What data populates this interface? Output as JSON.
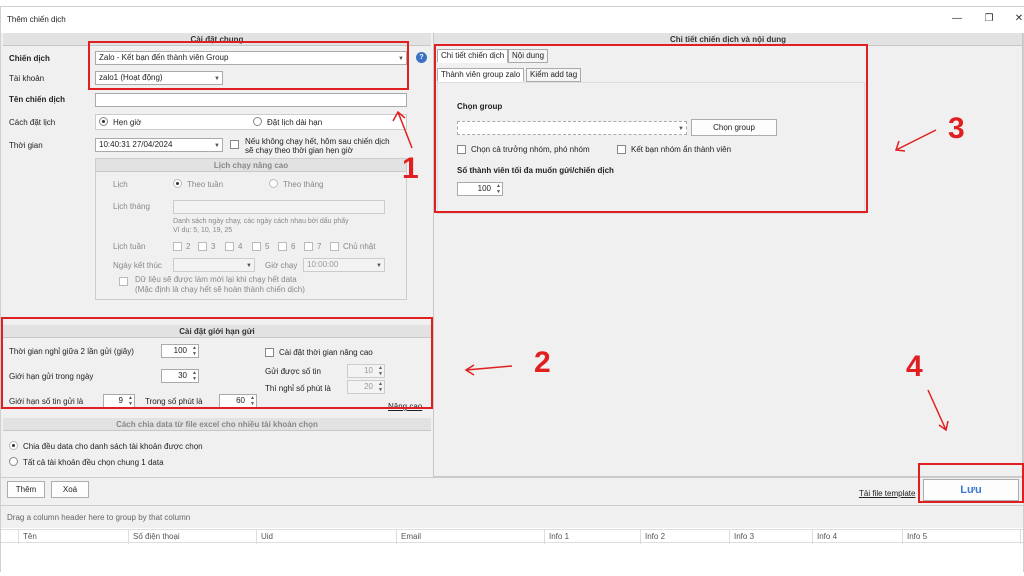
{
  "window": {
    "title": "Thêm chiến dịch",
    "minimize": "—",
    "restore": "❐",
    "close": "✕"
  },
  "general": {
    "header": "Cài đặt chung",
    "campaign_label": "Chiến dịch",
    "campaign_value": "Zalo - Kết bạn đến thành viên Group",
    "account_label": "Tài khoản",
    "account_value": "zalo1 (Hoạt động)",
    "name_label": "Tên chiến dịch",
    "name_value": "",
    "schedule_label": "Cách đặt lịch",
    "schedule_opt1": "Hẹn giờ",
    "schedule_opt2": "Đặt lịch dài hạn",
    "time_label": "Thời gian",
    "time_value": "10:40:31 27/04/2024",
    "rerun_note_1": "Nếu không chạy hết, hôm sau chiến dịch",
    "rerun_note_2": "sẽ chạy theo thời gian hẹn giờ"
  },
  "advanced": {
    "header": "Lịch chạy nâng cao",
    "schedule_label": "Lịch",
    "by_week": "Theo tuần",
    "by_month": "Theo tháng",
    "month_schedule_label": "Lịch tháng",
    "month_hint_1": "Danh sách ngày chạy, các ngày cách nhau bởi dấu phẩy",
    "month_hint_2": "Ví dụ: 5, 10, 19, 25",
    "week_schedule_label": "Lịch tuần",
    "days": [
      "2",
      "3",
      "4",
      "5",
      "6",
      "7",
      "Chủ nhật"
    ],
    "end_date_label": "Ngày kết thúc",
    "run_time_label": "Giờ chạy",
    "run_time_value": "10:00:00",
    "refresh_note_1": "Dữ liệu sẽ được làm mới lại khi chạy hết data",
    "refresh_note_2": "(Mặc định là chạy hết sẽ hoàn thành chiến dịch)"
  },
  "limits": {
    "header": "Cài đặt giới hạn gửi",
    "rest_label": "Thời gian nghỉ giữa 2 lần gửi (giây)",
    "rest_value": "100",
    "daily_label": "Giới hạn gửi trong ngày",
    "daily_value": "30",
    "count_label": "Giới hạn số tin gửi là",
    "count_value": "9",
    "minutes_label": "Trong số phút là",
    "minutes_value": "60",
    "adv_time_label": "Cài đặt thời gian nâng cao",
    "sent_label": "Gửi được số tin",
    "sent_value": "10",
    "rest_min_label": "Thì nghỉ số phút là",
    "rest_min_value": "20",
    "advanced_link": "Nâng cao"
  },
  "split": {
    "header": "Cách chia data từ file excel cho nhiều tài khoản chọn",
    "opt1": "Chia đều data cho danh sách tài khoản được chọn",
    "opt2": "Tất cả tài khoản đều chọn chung 1 data"
  },
  "detail": {
    "header": "Chi tiết chiến dịch và nội dung",
    "tab1": "Chi tiết chiến dịch",
    "tab2": "Nội dung",
    "subtab1": "Thành viên group zalo",
    "subtab2": "Kiểm add tag",
    "group_label": "Chọn group",
    "group_value": "",
    "choose_group_button": "Chọn group",
    "chk_leader": "Chọn cả trưởng nhóm, phó nhóm",
    "chk_hidden": "Kết bạn nhóm ẩn thành viên",
    "max_label": "Số thành viên tối đa muốn gửi/chiến dịch",
    "max_value": "100"
  },
  "footer": {
    "add_button": "Thêm",
    "delete_button": "Xoá",
    "template_link": "Tải file template",
    "save_button": "Lưu",
    "group_hint": "Drag a column header here to group by that column",
    "columns": [
      "Tên",
      "Số điện thoại",
      "Uid",
      "Email",
      "Info 1",
      "Info 2",
      "Info 3",
      "Info 4",
      "Info 5"
    ]
  },
  "annotations": [
    "1",
    "2",
    "3",
    "4"
  ],
  "colors": {
    "annotation": "#e02020",
    "link": "#1a55c8",
    "save_text": "#3a7bd5"
  }
}
